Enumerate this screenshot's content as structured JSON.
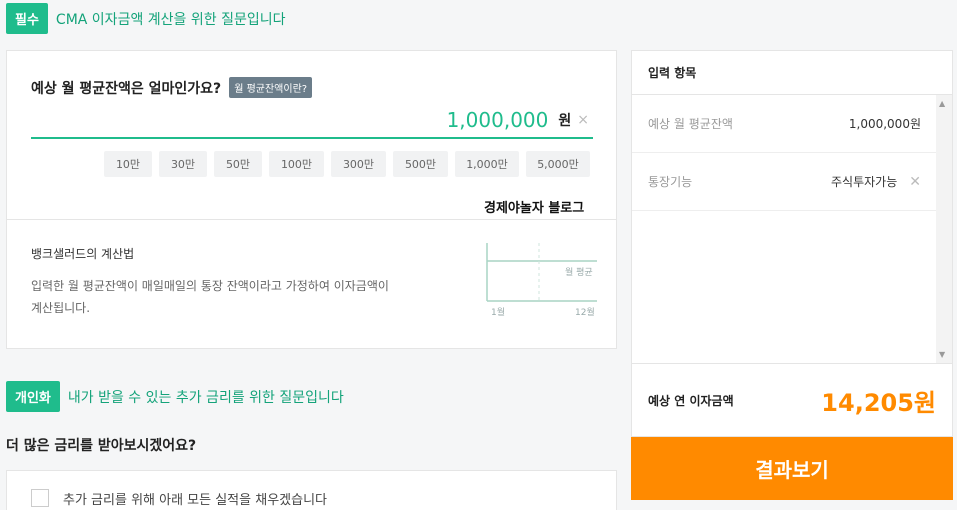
{
  "section1": {
    "badge": "필수",
    "title": "CMA 이자금액 계산을 위한 질문입니다"
  },
  "question": {
    "label": "예상 월 평균잔액은 얼마인가요?",
    "tag": "월 평균잔액이란?",
    "amount": "1,000,000",
    "unit": "원",
    "clear": "×",
    "chips": [
      "10만",
      "30만",
      "50만",
      "100만",
      "300만",
      "500만",
      "1,000만",
      "5,000만"
    ]
  },
  "watermark": "경제야놀자 블로그",
  "calc": {
    "title": "뱅크샐러드의 계산법",
    "desc": "입력한 월 평균잔액이 매일매일의 통장 잔액이라고 가정하여 이자금액이 계산됩니다.",
    "chart": {
      "series_label": "월 평균",
      "x_start": "1월",
      "x_end": "12월"
    }
  },
  "section2": {
    "badge": "개인화",
    "title": "내가 받을 수 있는 추가 금리를 위한 질문입니다",
    "question": "더 많은 금리를 받아보시겠어요?",
    "checkbox_label": "추가 금리를 위해 아래 모든 실적을 채우겠습니다"
  },
  "side": {
    "title": "입력 항목",
    "rows": [
      {
        "key": "예상 월 평균잔액",
        "value": "1,000,000원"
      },
      {
        "key": "통장기능",
        "value": "주식투자가능"
      }
    ],
    "result_key": "예상 연 이자금액",
    "result_value": "14,205원",
    "button": "결과보기"
  },
  "colors": {
    "accent": "#1fbc8c",
    "orange": "#ff8a00"
  }
}
